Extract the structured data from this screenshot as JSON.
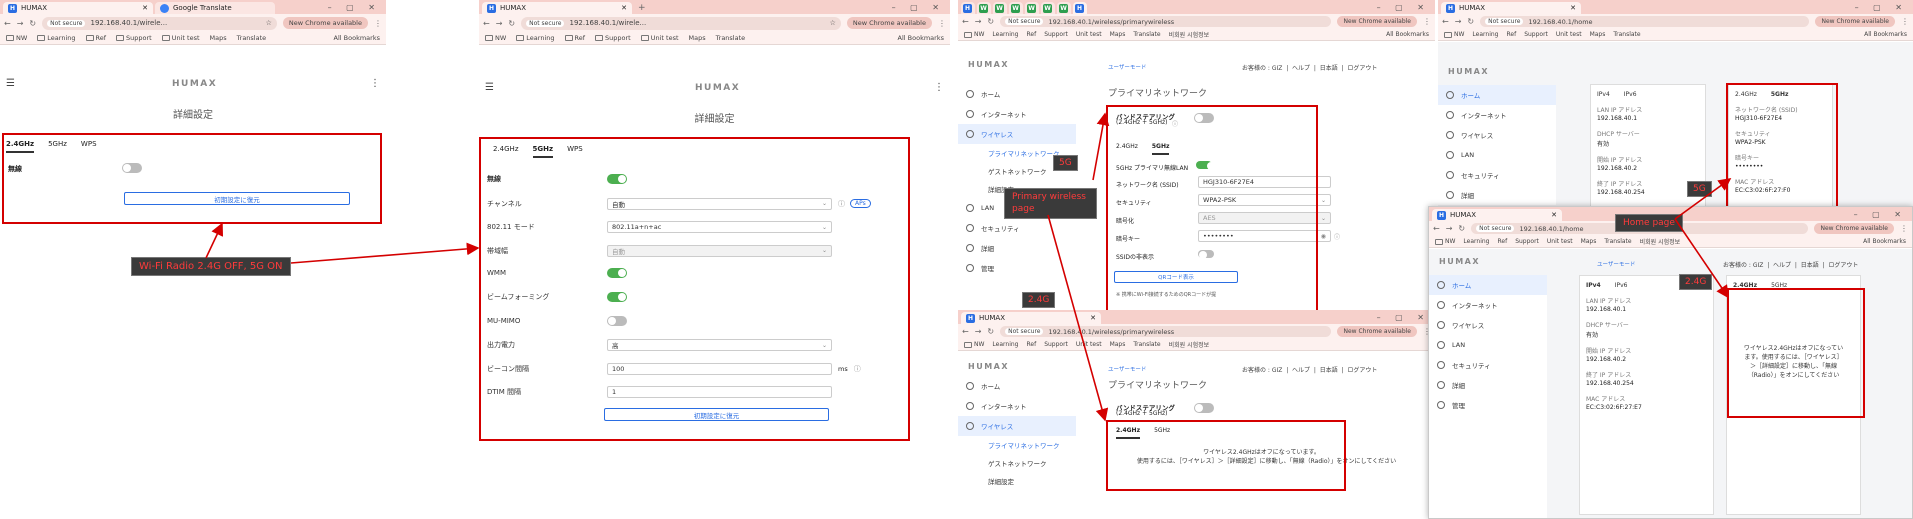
{
  "browser": {
    "tab_humax": "HUMAX",
    "tab_translate": "Google Translate",
    "not_secure": "Not secure",
    "new_chrome": "New Chrome available",
    "all_bookmarks": "All Bookmarks",
    "bookmarks": [
      "NW",
      "Learning",
      "Ref",
      "Support",
      "Unit test",
      "Maps",
      "Translate"
    ],
    "bookmark_extra": "비회원 시험정보"
  },
  "urls": {
    "p1": "192.168.40.1/wirele...",
    "p2": "192.168.40.1/wirele...",
    "p3": "192.168.40.1/wireless/primarywireless",
    "p4": "192.168.40.1/home"
  },
  "app": {
    "brand": "HUMAX",
    "advanced_title": "詳細設定",
    "tab_24": "2.4GHz",
    "tab_5": "5GHz",
    "tab_wps": "WPS",
    "wireless": "無線",
    "reset_button": "初期設定に復元",
    "user_mode": "ユーザーモード",
    "header_links": {
      "welcome": "お客様の : GIZ",
      "help": "ヘルプ",
      "lang": "日本語",
      "logout": "ログアウト"
    },
    "primary_title": "プライマリネットワーク",
    "band_steering": "バンドステアリング",
    "band_steering_sub": "(2.4GHz + 5GHz)"
  },
  "adv5": {
    "rows": [
      {
        "label": "無線",
        "kind": "toggle_on"
      },
      {
        "label": "チャンネル",
        "value": "自動",
        "extra": "APs"
      },
      {
        "label": "802.11 モード",
        "value": "802.11a+n+ac"
      },
      {
        "label": "帯域幅",
        "value": "自動"
      },
      {
        "label": "WMM",
        "kind": "toggle_on"
      },
      {
        "label": "ビームフォーミング",
        "kind": "toggle_on"
      },
      {
        "label": "MU-MIMO",
        "kind": "toggle_off"
      },
      {
        "label": "出力電力",
        "value": "高"
      },
      {
        "label": "ビーコン間隔",
        "value": "100",
        "unit": "ms"
      },
      {
        "label": "DTIM 間隔",
        "value": "1"
      }
    ]
  },
  "sidebar": {
    "home": "ホーム",
    "internet": "インターネット",
    "wireless": "ワイヤレス",
    "primary": "プライマリネットワーク",
    "guest": "ゲストネットワーク",
    "detail": "詳細設定",
    "lan": "LAN",
    "security": "セキュリティ",
    "details": "詳細",
    "manage": "管理"
  },
  "primary5": {
    "radio_label": "5GHz プライマリ無線LAN",
    "ssid_label": "ネットワーク名 (SSID)",
    "ssid_value": "HGJ310-6F27E4",
    "security_label": "セキュリティ",
    "security_value": "WPA2-PSK",
    "enc_label": "暗号化",
    "enc_value": "AES",
    "key_label": "暗号キー",
    "key_value": "••••••••",
    "hide_ssid": "SSIDの非表示",
    "qr_button": "QRコード表示",
    "qr_note": "※ 携帯にWi-Fi接続するためのQRコードが提"
  },
  "primary24": {
    "off_line1": "ワイヤレス2.4GHzはオフになっています。",
    "off_line2": "使用するには、［ワイヤレス］＞［詳細設定］に移動し、「無線（Radio）」をオンにしてください"
  },
  "home": {
    "tab_ipv4": "IPv4",
    "tab_ipv6": "IPv6",
    "lan_ip_label": "LAN IP アドレス",
    "lan_ip": "192.168.40.1",
    "dhcp_label": "DHCP サーバー",
    "dhcp": "有効",
    "start_ip_label": "開始 IP アドレス",
    "start_ip": "192.168.40.2",
    "end_ip_label": "終了 IP アドレス",
    "end_ip": "192.168.40.254",
    "mac_label": "MAC アドレス",
    "mac": "EC:C3:02:6F:27:E7",
    "w_ssid_label": "ネットワーク名 (SSID)",
    "w_ssid": "HGJ310-6F27E4",
    "w_sec_label": "セキュリティ",
    "w_sec": "WPA2-PSK",
    "w_key_label": "暗号キー",
    "w_key": "••••••••",
    "w_mac_label": "MAC アドレス",
    "w_mac": "EC:C3:02:6F:27:F0",
    "off_msg": "ワイヤレス2.4GHzはオフになっています。使用するには、［ワイヤレス］＞［詳細設定］に移動し、「無線（Radio）」をオンにしてください"
  },
  "annotations": {
    "radio_note": "Wi-Fi Radio 2.4G OFF, 5G ON",
    "primary_page": "Primary wireless page",
    "home_page": "Home page",
    "g5a": "5G",
    "g24a": "2.4G",
    "g5b": "5G",
    "g24b": "2.4G"
  }
}
